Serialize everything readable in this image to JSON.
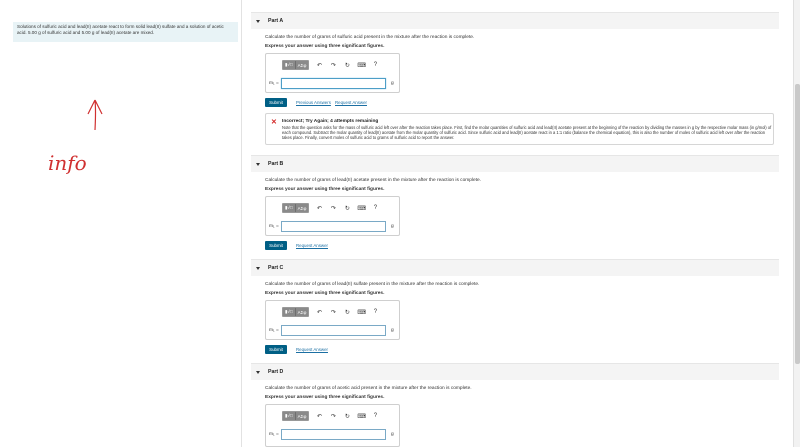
{
  "intro": "Solutions of sulfuric acid and lead(II) acetate react to form solid lead(II) sulfate and a solution of acetic acid. 5.00 g of sulfuric acid and 5.00 g of lead(II) acetate are mixed.",
  "handwriting": {
    "arrow": "↑",
    "note": "info"
  },
  "toolbar": {
    "matrix": "▮√□",
    "greek": "ΑΣφ",
    "undo": "↶",
    "redo": "↷",
    "reset": "↻",
    "keyboard": "⌨",
    "help": "?"
  },
  "common": {
    "instruction": "Express your answer using three significant figures.",
    "var_label": "m₁ =",
    "unit": "g",
    "submit": "Submit",
    "request_answer": "Request Answer",
    "previous_answers": "Previous Answers"
  },
  "parts": [
    {
      "title": "Part A",
      "question": "Calculate the number of grams of sulfuric acid  present in the mixture after the reaction is complete."
    },
    {
      "title": "Part B",
      "question": "Calculate the number of grams of lead(II) acetate present in the mixture after the reaction is complete."
    },
    {
      "title": "Part C",
      "question": "Calculate the number of grams of lead(II) sulfate present in the mixture after the reaction is complete."
    },
    {
      "title": "Part D",
      "question": "Calculate the number of grams of acetic acid present in the mixture after the reaction is complete."
    }
  ],
  "feedback": {
    "title": "Incorrect; Try Again; 4 attempts remaining",
    "text": "Note that the question asks for the mass of sulfuric acid left over after the reaction takes place.  First, find the molar quantities of sulfuric acid and lead(II) acetate present at the beginning of the reaction by dividing the masses in g by the respective molar mass (in g/mol) of each compound. Subtract the molar quantity of lead(II) acetate from the molar quantity of sulfuric acid. Since sulfuric acid and lead(II) acetate react in a 1:1 ratio (balance the chemical equation), this is also the number of moles of sulfuric acid left over after the reaction takes place. Finally, convert moles of sulfuric acid to grams of sulfuric acid to report the answer."
  }
}
